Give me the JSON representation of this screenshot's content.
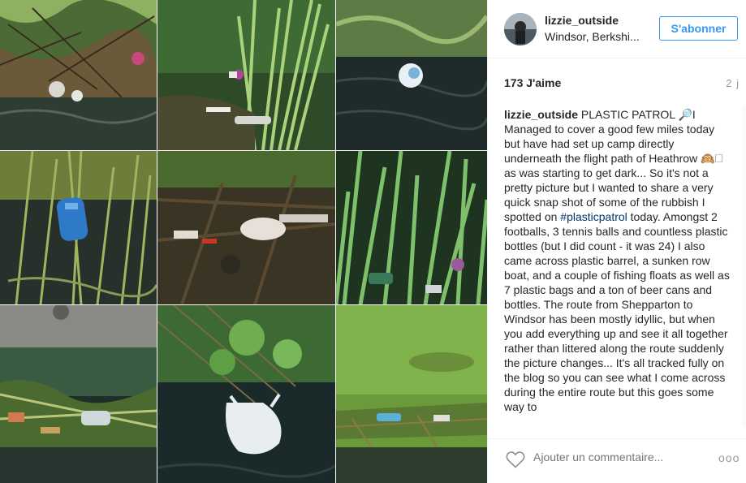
{
  "post": {
    "username": "lizzie_outside",
    "location": "Windsor, Berkshi...",
    "follow_label": "S'abonner",
    "likes": "173 J'aime",
    "time": "2 j",
    "caption_user": "lizzie_outside",
    "caption_part1": "PLASTIC PATROL 🔎I Managed to cover a good few miles today but have had set up camp directly underneath the flight path of Heathrow 🙉🗆 as was starting to get dark... So it's not a pretty picture but I wanted to share a very quick snap shot of some of the rubbish I spotted on ",
    "caption_hashtag": "#plasticpatrol",
    "caption_part2": " today. Amongst 2 footballs, 3 tennis balls and countless plastic bottles (but I did count - it was 24) I also came across plastic barrel, a sunken row boat, and a couple of fishing floats as well as 7 plastic bags and a ton of beer cans and bottles. The route from Shepparton to Windsor has been mostly idyllic, but when you add everything up and see it all together rather than littered along the route suddenly the picture changes... It's all tracked fully on the blog so you can see what I come across during the entire route but this goes some way to",
    "comment_placeholder": "Ajouter un commentaire...",
    "more_label": "ooo"
  },
  "icons": {
    "heart": "heart-outline-icon",
    "more": "more-options-icon"
  },
  "colors": {
    "accent": "#3897f0",
    "hashtag": "#003569",
    "muted": "#999999"
  }
}
